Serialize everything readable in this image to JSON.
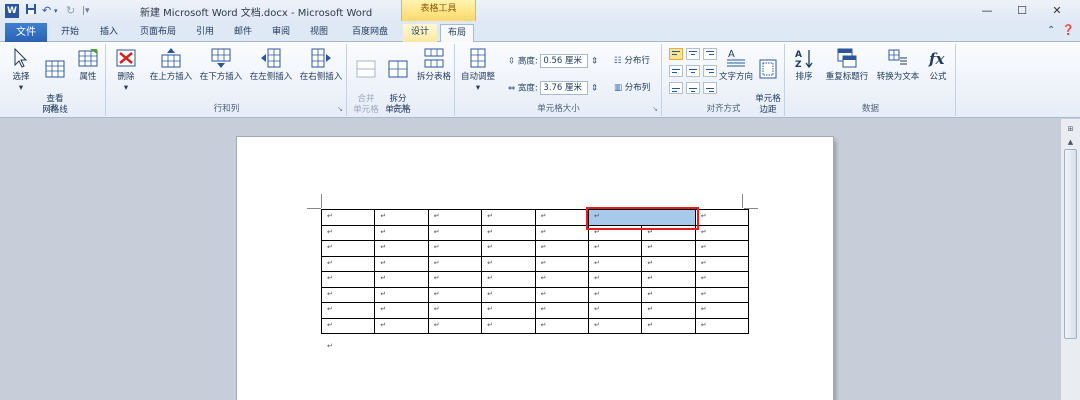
{
  "titlebar": {
    "title": "新建 Microsoft Word 文档.docx - Microsoft Word",
    "context_label": "表格工具",
    "word_letter": "W"
  },
  "tabs": {
    "file": "文件",
    "items": [
      "开始",
      "插入",
      "页面布局",
      "引用",
      "邮件",
      "审阅",
      "视图",
      "百度网盘",
      "设计",
      "布局"
    ]
  },
  "ribbon": {
    "table_group": {
      "label": "表",
      "select": "选择",
      "gridlines": "查看\n网格线",
      "properties": "属性"
    },
    "rows_cols_group": {
      "label": "行和列",
      "delete": "删除",
      "insert_above": "在上方插入",
      "insert_below": "在下方插入",
      "insert_left": "在左侧插入",
      "insert_right": "在右侧插入"
    },
    "merge_group": {
      "label": "合并",
      "merge_cells": "合并\n单元格",
      "split_cells": "拆分\n单元格",
      "split_table": "拆分表格"
    },
    "cell_size_group": {
      "label": "单元格大小",
      "autofit": "自动调整",
      "height_label": "高度:",
      "height_value": "0.56 厘米",
      "width_label": "宽度:",
      "width_value": "3.76 厘米",
      "dist_rows": "分布行",
      "dist_cols": "分布列"
    },
    "alignment_group": {
      "label": "对齐方式",
      "text_direction": "文字方向",
      "cell_margins": "单元格\n边距"
    },
    "data_group": {
      "label": "数据",
      "sort": "排序",
      "repeat_header": "重复标题行",
      "to_text": "转换为文本",
      "formula": "公式"
    }
  },
  "document": {
    "paragraph_mark": "↵",
    "table": {
      "rows": 8,
      "cols": 8,
      "selected_row": 0,
      "selected_cols": [
        5,
        6
      ]
    }
  },
  "colors": {
    "accent": "#2b579a",
    "selection": "#a6c9ec",
    "highlight_box": "#e02020",
    "context_tab": "#ffd96a"
  }
}
